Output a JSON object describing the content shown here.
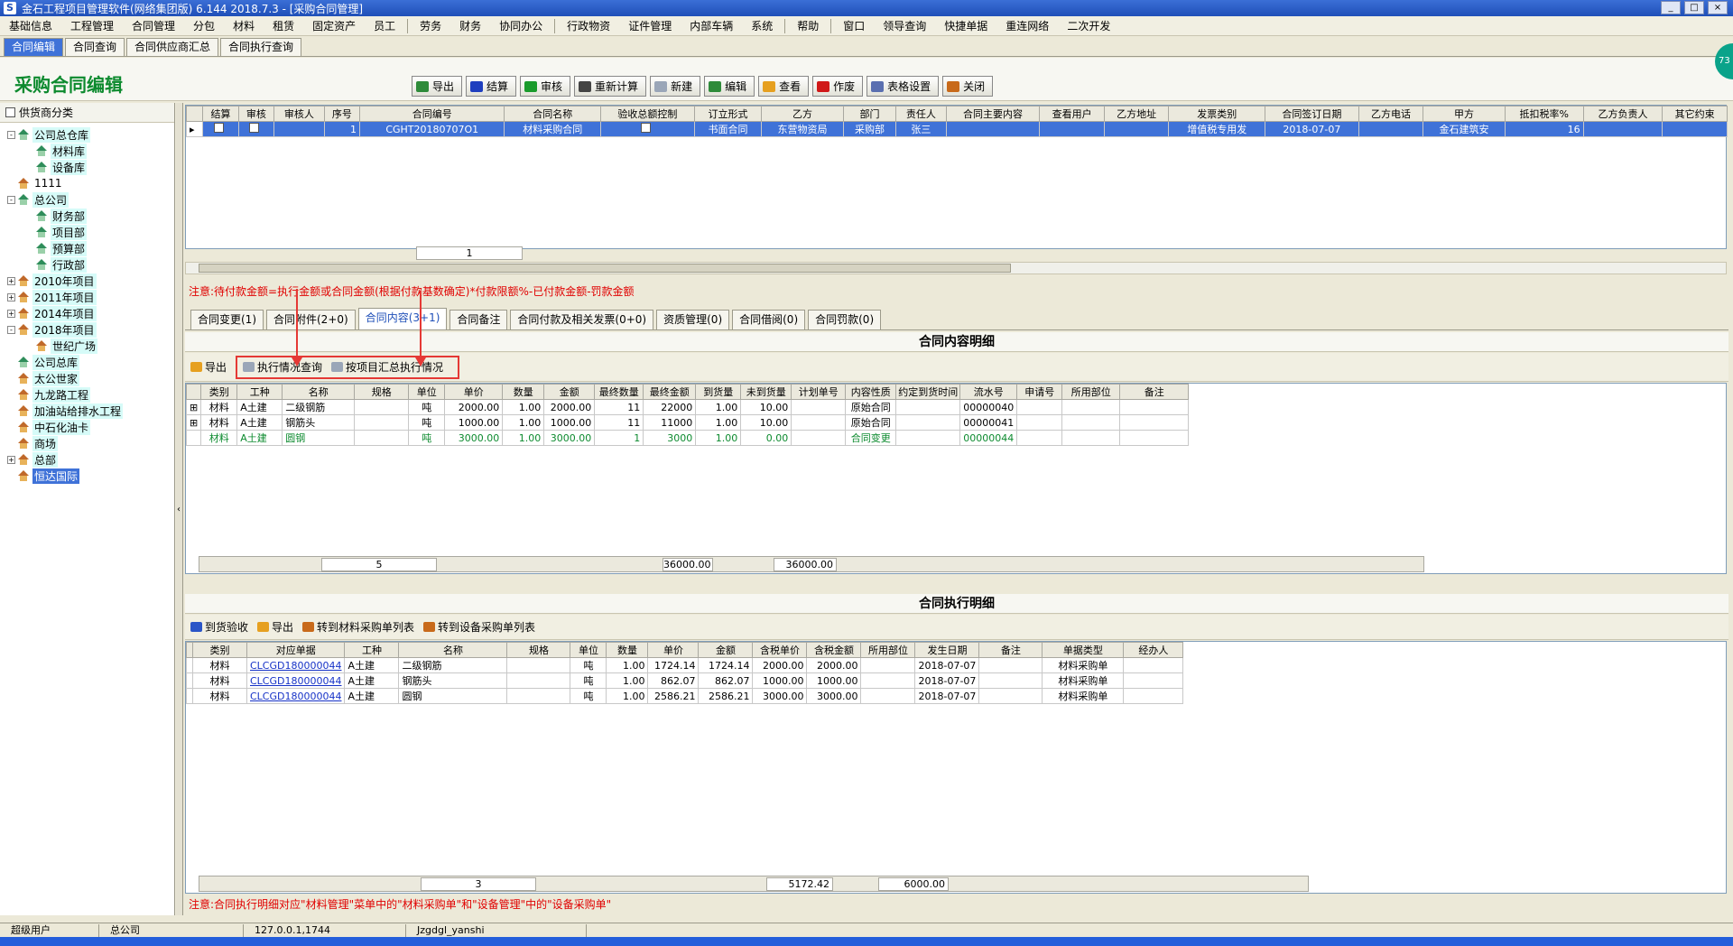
{
  "window": {
    "title": "金石工程项目管理软件(网络集团版) 6.144  2018.7.3 - [采购合同管理]",
    "badge": "73"
  },
  "menu": [
    "基础信息",
    "工程管理",
    "合同管理",
    "分包",
    "材料",
    "租赁",
    "固定资产",
    "员工",
    "劳务",
    "财务",
    "协同办公",
    "行政物资",
    "证件管理",
    "内部车辆",
    "系统",
    "帮助",
    "窗口",
    "领导查询",
    "快捷单据",
    "重连网络",
    "二次开发"
  ],
  "tabs": [
    "合同编辑",
    "合同查询",
    "合同供应商汇总",
    "合同执行查询"
  ],
  "page": {
    "title": "采购合同编辑"
  },
  "toolbar": [
    {
      "label": "导出",
      "color": "#2e8b3a"
    },
    {
      "label": "结算",
      "color": "#1f3fbf"
    },
    {
      "label": "审核",
      "color": "#1a9b2c"
    },
    {
      "label": "重新计算",
      "color": "#444444"
    },
    {
      "label": "新建",
      "color": "#9aa6b8"
    },
    {
      "label": "编辑",
      "color": "#2e8b3a"
    },
    {
      "label": "查看",
      "color": "#e6a020"
    },
    {
      "label": "作废",
      "color": "#d01818"
    },
    {
      "label": "表格设置",
      "color": "#5a6fb0"
    },
    {
      "label": "关闭",
      "color": "#c86a1a"
    }
  ],
  "left": {
    "header": "供货商分类",
    "tree": [
      {
        "label": "公司总仓库",
        "indent": 0,
        "exp": "-",
        "icon": "g",
        "hl": true
      },
      {
        "label": "材料库",
        "indent": 1,
        "exp": "",
        "icon": "g",
        "hl": true
      },
      {
        "label": "设备库",
        "indent": 1,
        "exp": "",
        "icon": "g",
        "hl": true
      },
      {
        "label": "1111",
        "indent": 0,
        "exp": "",
        "icon": "h",
        "hl": false
      },
      {
        "label": "总公司",
        "indent": 0,
        "exp": "-",
        "icon": "g",
        "hl": true
      },
      {
        "label": "财务部",
        "indent": 1,
        "exp": "",
        "icon": "g",
        "hl": true
      },
      {
        "label": "项目部",
        "indent": 1,
        "exp": "",
        "icon": "g",
        "hl": true
      },
      {
        "label": "预算部",
        "indent": 1,
        "exp": "",
        "icon": "g",
        "hl": true
      },
      {
        "label": "行政部",
        "indent": 1,
        "exp": "",
        "icon": "g",
        "hl": true
      },
      {
        "label": "2010年项目",
        "indent": 0,
        "exp": "+",
        "icon": "h",
        "hl": true
      },
      {
        "label": "2011年项目",
        "indent": 0,
        "exp": "+",
        "icon": "h",
        "hl": true
      },
      {
        "label": "2014年项目",
        "indent": 0,
        "exp": "+",
        "icon": "h",
        "hl": true
      },
      {
        "label": "2018年项目",
        "indent": 0,
        "exp": "-",
        "icon": "h",
        "hl": true
      },
      {
        "label": "世纪广场",
        "indent": 1,
        "exp": "",
        "icon": "h",
        "hl": true
      },
      {
        "label": "公司总库",
        "indent": 0,
        "exp": "",
        "icon": "g",
        "hl": true
      },
      {
        "label": "太公世家",
        "indent": 0,
        "exp": "",
        "icon": "h",
        "hl": true
      },
      {
        "label": "九龙路工程",
        "indent": 0,
        "exp": "",
        "icon": "h",
        "hl": true
      },
      {
        "label": "加油站给排水工程",
        "indent": 0,
        "exp": "",
        "icon": "h",
        "hl": true
      },
      {
        "label": "中石化油卡",
        "indent": 0,
        "exp": "",
        "icon": "h",
        "hl": true
      },
      {
        "label": "商场",
        "indent": 0,
        "exp": "",
        "icon": "h",
        "hl": true
      },
      {
        "label": "总部",
        "indent": 0,
        "exp": "+",
        "icon": "h",
        "hl": true
      },
      {
        "label": "恒达国际",
        "indent": 0,
        "exp": "",
        "icon": "h",
        "hl": false,
        "sel": true
      }
    ]
  },
  "contracts": {
    "columns": [
      "结算",
      "审核",
      "审核人",
      "序号",
      "合同编号",
      "合同名称",
      "验收总额控制",
      "订立形式",
      "乙方",
      "部门",
      "责任人",
      "合同主要内容",
      "查看用户",
      "乙方地址",
      "发票类别",
      "合同签订日期",
      "乙方电话",
      "甲方",
      "抵扣税率%",
      "乙方负责人",
      "其它约束"
    ],
    "rows": [
      [
        "",
        "",
        "",
        "1",
        "CGHT20180707O1",
        "材料采购合同",
        "",
        "书面合同",
        "东营物资局",
        "采购部",
        "张三",
        "",
        "",
        "",
        "增值税专用发",
        "2018-07-07",
        "",
        "金石建筑安",
        "16",
        "",
        ""
      ]
    ],
    "footer_count": "1"
  },
  "notes": {
    "top": "注意:待付款金额=执行金额或合同金额(根据付款基数确定)*付款限额%-已付款金额-罚款金额",
    "bottom": "注意:合同执行明细对应\"材料管理\"菜单中的\"材料采购单\"和\"设备管理\"中的\"设备采购单\""
  },
  "subtabs": [
    "合同变更(1)",
    "合同附件(2+0)",
    "合同内容(3+1)",
    "合同备注",
    "合同付款及相关发票(0+0)",
    "资质管理(0)",
    "合同借阅(0)",
    "合同罚款(0)"
  ],
  "content": {
    "title": "合同内容明细",
    "actions": {
      "export": "导出",
      "query": "执行情况查询",
      "summary": "按项目汇总执行情况"
    },
    "columns": [
      "类别",
      "工种",
      "名称",
      "规格",
      "单位",
      "单价",
      "数量",
      "金额",
      "最终数量",
      "最终金额",
      "到货量",
      "未到货量",
      "计划单号",
      "内容性质",
      "约定到货时间",
      "流水号",
      "申请号",
      "所用部位",
      "备注"
    ],
    "rows": [
      {
        "exp": "+",
        "green": false,
        "cells": [
          "材料",
          "A土建",
          "二级钢筋",
          "",
          "吨",
          "2000.00",
          "1.00",
          "2000.00",
          "11",
          "22000",
          "1.00",
          "10.00",
          "",
          "原始合同",
          "",
          "00000040",
          "",
          "",
          ""
        ]
      },
      {
        "exp": "+",
        "green": false,
        "cells": [
          "材料",
          "A土建",
          "钢筋头",
          "",
          "吨",
          "1000.00",
          "1.00",
          "1000.00",
          "11",
          "11000",
          "1.00",
          "10.00",
          "",
          "原始合同",
          "",
          "00000041",
          "",
          "",
          ""
        ]
      },
      {
        "exp": "",
        "green": true,
        "cells": [
          "材料",
          "A土建",
          "圆钢",
          "",
          "吨",
          "3000.00",
          "1.00",
          "3000.00",
          "1",
          "3000",
          "1.00",
          "0.00",
          "",
          "合同变更",
          "",
          "00000044",
          "",
          "",
          ""
        ]
      }
    ],
    "sum": {
      "count": "5",
      "amount": "36000.00",
      "final_amount": "36000.00"
    }
  },
  "execution": {
    "title": "合同执行明细",
    "actions": {
      "receive": "到货验收",
      "export": "导出",
      "to_material": "转到材料采购单列表",
      "to_equipment": "转到设备采购单列表"
    },
    "columns": [
      "类别",
      "对应单据",
      "工种",
      "名称",
      "规格",
      "单位",
      "数量",
      "单价",
      "金额",
      "含税单价",
      "含税金额",
      "所用部位",
      "发生日期",
      "备注",
      "单据类型",
      "经办人"
    ],
    "rows": [
      [
        "材料",
        "CLCGD180000044",
        "A土建",
        "二级钢筋",
        "",
        "吨",
        "1.00",
        "1724.14",
        "1724.14",
        "2000.00",
        "2000.00",
        "",
        "2018-07-07",
        "",
        "材料采购单",
        ""
      ],
      [
        "材料",
        "CLCGD180000044",
        "A土建",
        "钢筋头",
        "",
        "吨",
        "1.00",
        "862.07",
        "862.07",
        "1000.00",
        "1000.00",
        "",
        "2018-07-07",
        "",
        "材料采购单",
        ""
      ],
      [
        "材料",
        "CLCGD180000044",
        "A土建",
        "圆钢",
        "",
        "吨",
        "1.00",
        "2586.21",
        "2586.21",
        "3000.00",
        "3000.00",
        "",
        "2018-07-07",
        "",
        "材料采购单",
        ""
      ]
    ],
    "sum": {
      "count": "3",
      "amount": "5172.42",
      "tax_amount": "6000.00"
    }
  },
  "status": [
    "超级用户",
    "总公司",
    "127.0.0.1,1744",
    "Jzgdgl_yanshi"
  ]
}
